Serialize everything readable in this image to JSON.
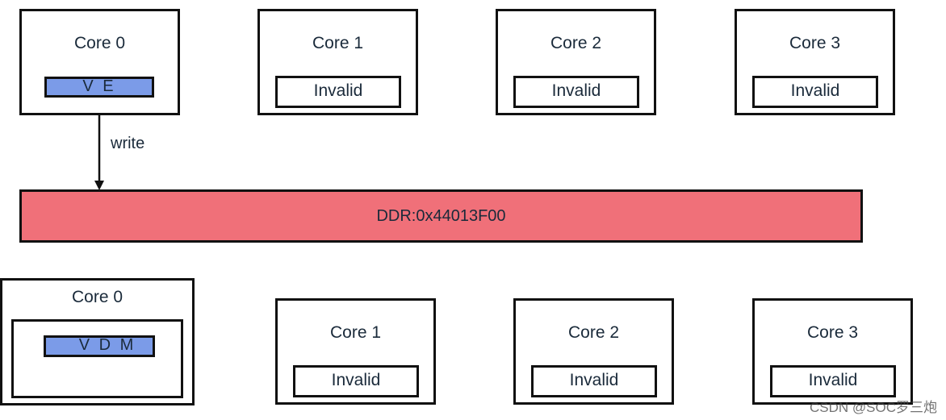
{
  "top_row": [
    {
      "title": "Core 0",
      "register": "V E",
      "register_color": "#7b9be8"
    },
    {
      "title": "Core 1",
      "state": "Invalid"
    },
    {
      "title": "Core 2",
      "state": "Invalid"
    },
    {
      "title": "Core 3",
      "state": "Invalid"
    }
  ],
  "arrow_label": "write",
  "ddr": {
    "label": "DDR:0x44013F00",
    "color": "#f07079"
  },
  "bottom_row": [
    {
      "title": "Core 0",
      "register": "V D M",
      "register_color": "#7b9be8"
    },
    {
      "title": "Core 1",
      "state": "Invalid"
    },
    {
      "title": "Core 2",
      "state": "Invalid"
    },
    {
      "title": "Core 3",
      "state": "Invalid"
    }
  ],
  "watermark": "CSDN @SOC罗三炮"
}
